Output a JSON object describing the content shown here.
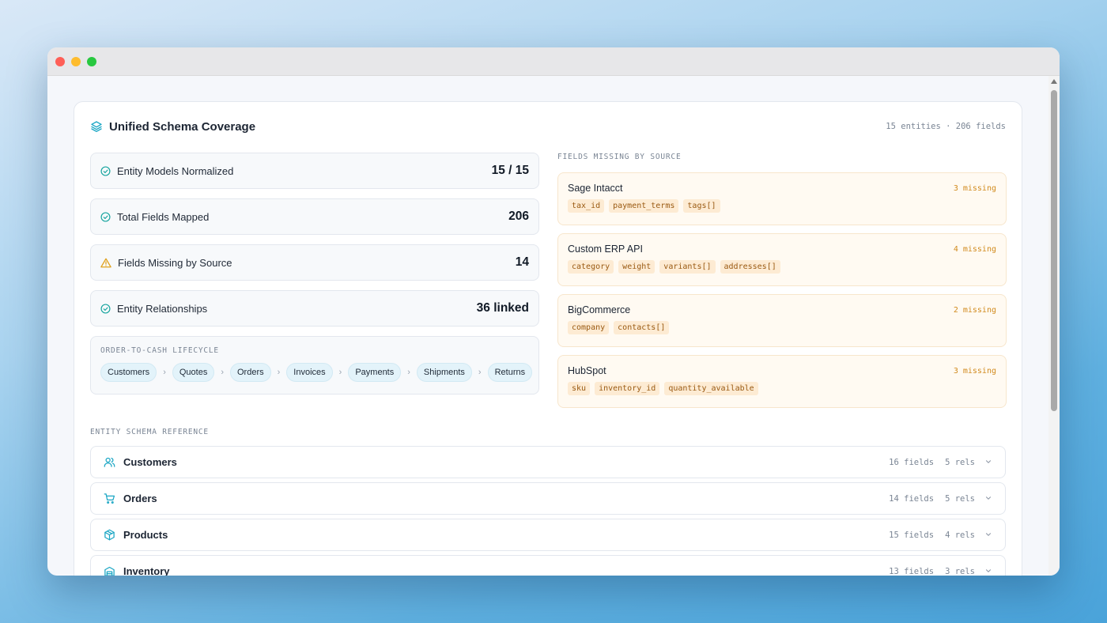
{
  "header": {
    "title": "Unified Schema Coverage",
    "summary": "15 entities · 206 fields"
  },
  "stats": [
    {
      "label": "Entity Models Normalized",
      "value": "15 / 15",
      "status": "ok"
    },
    {
      "label": "Total Fields Mapped",
      "value": "206",
      "status": "ok"
    },
    {
      "label": "Fields Missing by Source",
      "value": "14",
      "status": "warning"
    },
    {
      "label": "Entity Relationships",
      "value": "36 linked",
      "status": "ok"
    }
  ],
  "lifecycle": {
    "caption": "ORDER-TO-CASH LIFECYCLE",
    "steps": [
      "Customers",
      "Quotes",
      "Orders",
      "Invoices",
      "Payments",
      "Shipments",
      "Returns"
    ]
  },
  "missing": {
    "caption": "FIELDS MISSING BY SOURCE",
    "sources": [
      {
        "name": "Sage Intacct",
        "count": "3 missing",
        "fields": [
          "tax_id",
          "payment_terms",
          "tags[]"
        ]
      },
      {
        "name": "Custom ERP API",
        "count": "4 missing",
        "fields": [
          "category",
          "weight",
          "variants[]",
          "addresses[]"
        ]
      },
      {
        "name": "BigCommerce",
        "count": "2 missing",
        "fields": [
          "company",
          "contacts[]"
        ]
      },
      {
        "name": "HubSpot",
        "count": "3 missing",
        "fields": [
          "sku",
          "inventory_id",
          "quantity_available"
        ]
      }
    ]
  },
  "reference": {
    "caption": "ENTITY SCHEMA REFERENCE",
    "entities": [
      {
        "name": "Customers",
        "icon": "users-icon",
        "fields": "16 fields",
        "rels": "5 rels"
      },
      {
        "name": "Orders",
        "icon": "cart-icon",
        "fields": "14 fields",
        "rels": "5 rels"
      },
      {
        "name": "Products",
        "icon": "package-icon",
        "fields": "15 fields",
        "rels": "4 rels"
      },
      {
        "name": "Inventory",
        "icon": "warehouse-icon",
        "fields": "13 fields",
        "rels": "3 rels"
      }
    ]
  },
  "colors": {
    "accent": "#1aa6c4",
    "ok": "#1aa6a0",
    "warning": "#e0a21f",
    "missing_text": "#d18a1d"
  }
}
